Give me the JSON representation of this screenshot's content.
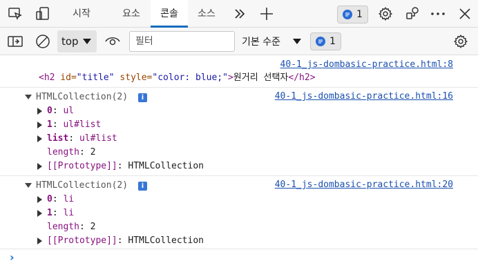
{
  "tabs": [
    {
      "label": "시작"
    },
    {
      "label": "요소"
    },
    {
      "label": "콘솔",
      "active": true
    },
    {
      "label": "소스"
    }
  ],
  "issues_count": "1",
  "toolbar": {
    "context": "top",
    "filter_placeholder": "필터",
    "level": "기본 수준",
    "issues_count": "1"
  },
  "colors": {
    "accent": "#0f6cbd",
    "link": "#1a4fb0",
    "tag": "#881280",
    "attr": "#994500",
    "attr_value": "#1a1aa6"
  },
  "messages": [
    {
      "source": "40-1_js-dombasic-practice.html:8",
      "html": {
        "open": "<h2",
        "id_attr": " id=",
        "id_val": "\"title\"",
        "style_attr": " style=",
        "style_val": "\"color: blue;\"",
        "close_open": ">",
        "text": "원거리 선택자",
        "close_tag": "</h2>"
      }
    },
    {
      "source": "40-1_js-dombasic-practice.html:16",
      "summary": "HTMLCollection(2)",
      "rows": [
        {
          "key": "0",
          "sep": ": ",
          "value": "ul"
        },
        {
          "key": "1",
          "sep": ": ",
          "value": "ul#list"
        },
        {
          "key": "list",
          "sep": ": ",
          "value": "ul#list"
        },
        {
          "key": "length",
          "sep": ": ",
          "value": "2"
        },
        {
          "key": "[[Prototype]]",
          "sep": ": ",
          "value": "HTMLCollection"
        }
      ]
    },
    {
      "source": "40-1_js-dombasic-practice.html:20",
      "summary": "HTMLCollection(2)",
      "rows": [
        {
          "key": "0",
          "sep": ": ",
          "value": "li"
        },
        {
          "key": "1",
          "sep": ": ",
          "value": "li"
        },
        {
          "key": "length",
          "sep": ": ",
          "value": "2"
        },
        {
          "key": "[[Prototype]]",
          "sep": ": ",
          "value": "HTMLCollection"
        }
      ]
    }
  ]
}
